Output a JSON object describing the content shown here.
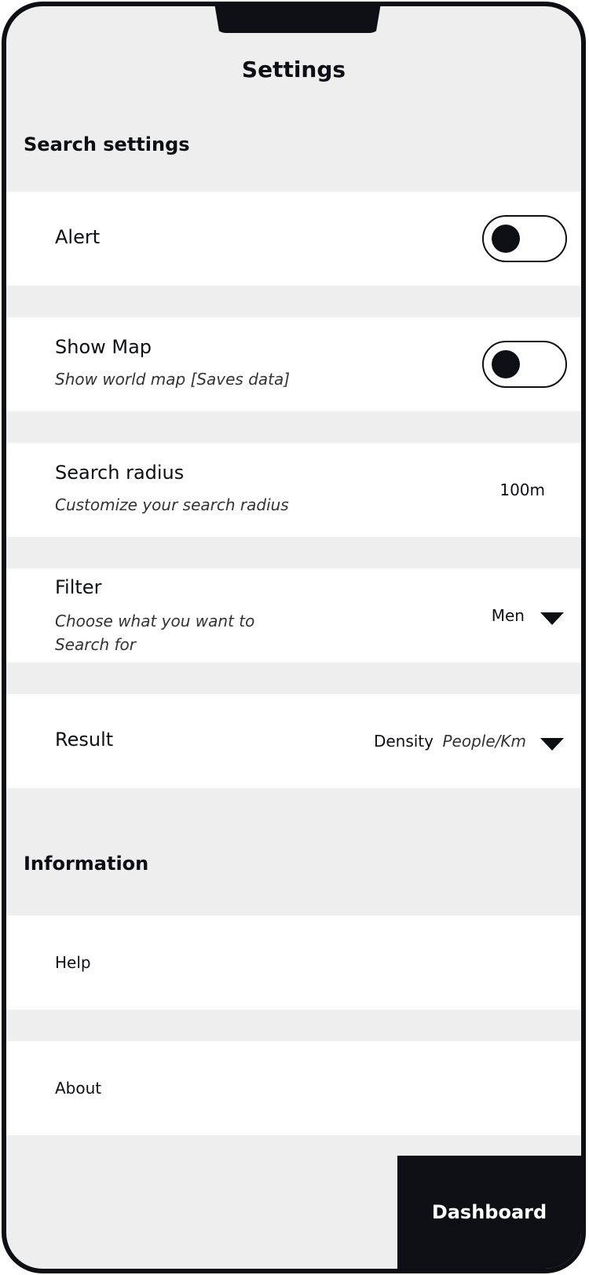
{
  "header": {
    "title": "Settings"
  },
  "sections": {
    "search": "Search settings",
    "information": "Information"
  },
  "alert": {
    "label": "Alert",
    "toggle_on": false
  },
  "show_map": {
    "label": "Show Map",
    "subtitle": "Show world map  [Saves data]",
    "toggle_on": false
  },
  "search_radius": {
    "label": "Search radius",
    "subtitle": "Customize your search radius",
    "value": "100m"
  },
  "filter": {
    "label": "Filter",
    "subtitle": "Choose what you want to Search for",
    "selected": "Men"
  },
  "result": {
    "label": "Result",
    "selected_main": "Density",
    "selected_unit": "People/Km"
  },
  "info_items": {
    "help": "Help",
    "about": "About"
  },
  "footer": {
    "dashboard_label": "Dashboard"
  },
  "colors": {
    "accent": "#0d0f14",
    "background": "#eeeeee",
    "card": "#ffffff"
  }
}
